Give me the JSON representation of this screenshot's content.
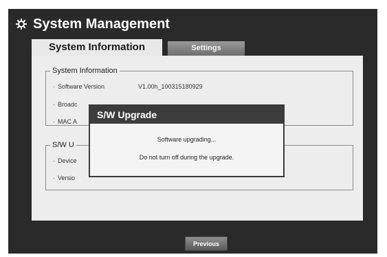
{
  "header": {
    "title": "System Management",
    "icon": "gear-icon"
  },
  "tabs": [
    {
      "label": "System Information",
      "active": true
    },
    {
      "label": "Settings",
      "active": false
    }
  ],
  "system_info": {
    "legend": "System Information",
    "rows": [
      {
        "label": "Software Version",
        "value": "V1.00h_100315180929"
      },
      {
        "label": "Broadc",
        "value": ""
      },
      {
        "label": "MAC A",
        "value": ""
      }
    ]
  },
  "sw_upgrade_group": {
    "legend": "S/W U",
    "rows": [
      {
        "label": "Device"
      },
      {
        "label": "Versio"
      }
    ]
  },
  "dialog": {
    "title": "S/W Upgrade",
    "message1": "Software upgrading...",
    "message2": "Do not turn off during the upgrade."
  },
  "footer": {
    "previous_label": "Previous"
  }
}
